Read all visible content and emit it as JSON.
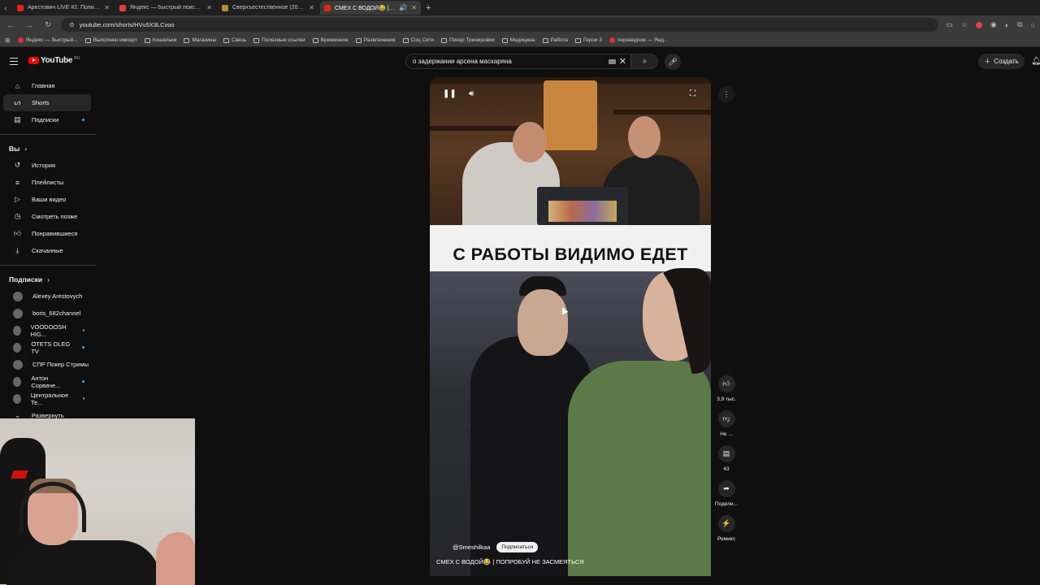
{
  "browser": {
    "tabs": [
      {
        "title": "Арестович LIVE #2. Политико",
        "favicon_color": "#e62117",
        "active": false
      },
      {
        "title": "Яндекс — быстрый поиск в и...",
        "favicon_color": "#e04040",
        "active": false
      },
      {
        "title": "Сверхъестественное (2005, се",
        "favicon_color": "#b58a3a",
        "active": false
      },
      {
        "title": "СМЕХ С ВОДОЙ😂 | ПОП",
        "favicon_color": "#e62117",
        "active": true
      }
    ],
    "url": "youtube.com/shorts/HVu5X3LCvoo",
    "bookmarks": [
      {
        "label": "Яндекс — быстрый...",
        "kind": "site"
      },
      {
        "label": "Выполнен импорт",
        "kind": "folder"
      },
      {
        "label": "Кошельки",
        "kind": "folder"
      },
      {
        "label": "Магазины",
        "kind": "folder"
      },
      {
        "label": "Связь",
        "kind": "folder"
      },
      {
        "label": "Полезные ссылки",
        "kind": "folder"
      },
      {
        "label": "Временное",
        "kind": "folder"
      },
      {
        "label": "Развлечения",
        "kind": "folder"
      },
      {
        "label": "Соц Сети",
        "kind": "folder"
      },
      {
        "label": "Покер Тренировки",
        "kind": "folder"
      },
      {
        "label": "Медицина",
        "kind": "folder"
      },
      {
        "label": "Работа",
        "kind": "folder"
      },
      {
        "label": "Герои 3",
        "kind": "folder"
      },
      {
        "label": "переводчик — Янд...",
        "kind": "site"
      }
    ]
  },
  "youtube": {
    "logo_text": "YouTube",
    "region": "RU",
    "search_value": "о задержании арсена маскаряна",
    "create_label": "Создать"
  },
  "sidebar": {
    "main": [
      {
        "label": "Главная",
        "icon": "home-icon",
        "active": false
      },
      {
        "label": "Shorts",
        "icon": "shorts-icon",
        "active": true
      },
      {
        "label": "Подписки",
        "icon": "subscriptions-icon",
        "active": false,
        "dot": true
      }
    ],
    "you_header": "Вы",
    "you": [
      {
        "label": "История",
        "icon": "history-icon"
      },
      {
        "label": "Плейлисты",
        "icon": "playlists-icon"
      },
      {
        "label": "Ваши видео",
        "icon": "your-videos-icon"
      },
      {
        "label": "Смотреть позже",
        "icon": "watch-later-icon"
      },
      {
        "label": "Понравившиеся",
        "icon": "liked-icon"
      },
      {
        "label": "Скачанные",
        "icon": "downloads-icon"
      }
    ],
    "subs_header": "Подписки",
    "subs": [
      {
        "label": "Alexey Arestovych",
        "dot": false
      },
      {
        "label": "boris_682channel",
        "dot": false
      },
      {
        "label": "VOODOOSH HIG...",
        "dot": true
      },
      {
        "label": "OTETS OLEG TV",
        "dot": true
      },
      {
        "label": "СПР Покер Стримы",
        "dot": false
      },
      {
        "label": "Антон Сорваче...",
        "dot": true
      },
      {
        "label": "Центральное Те...",
        "dot": true
      }
    ],
    "expand_label": "Развернуть"
  },
  "video": {
    "caption": "С РАБОТЫ ВИДИМО ЕДЕТ",
    "channel": "@Smeshilkaa",
    "subscribe_label": "Подписаться",
    "title": "СМЕХ С ВОДОЙ😂 | ПОПРОБУЙ НЕ ЗАСМЕЯТЬСЯ"
  },
  "actions": {
    "like_count": "3,9 тыс.",
    "dislike_label": "Не ...",
    "comments_count": "43",
    "share_label": "Поделиться",
    "share_short": "Подели...",
    "remix_label": "Ремикс"
  }
}
